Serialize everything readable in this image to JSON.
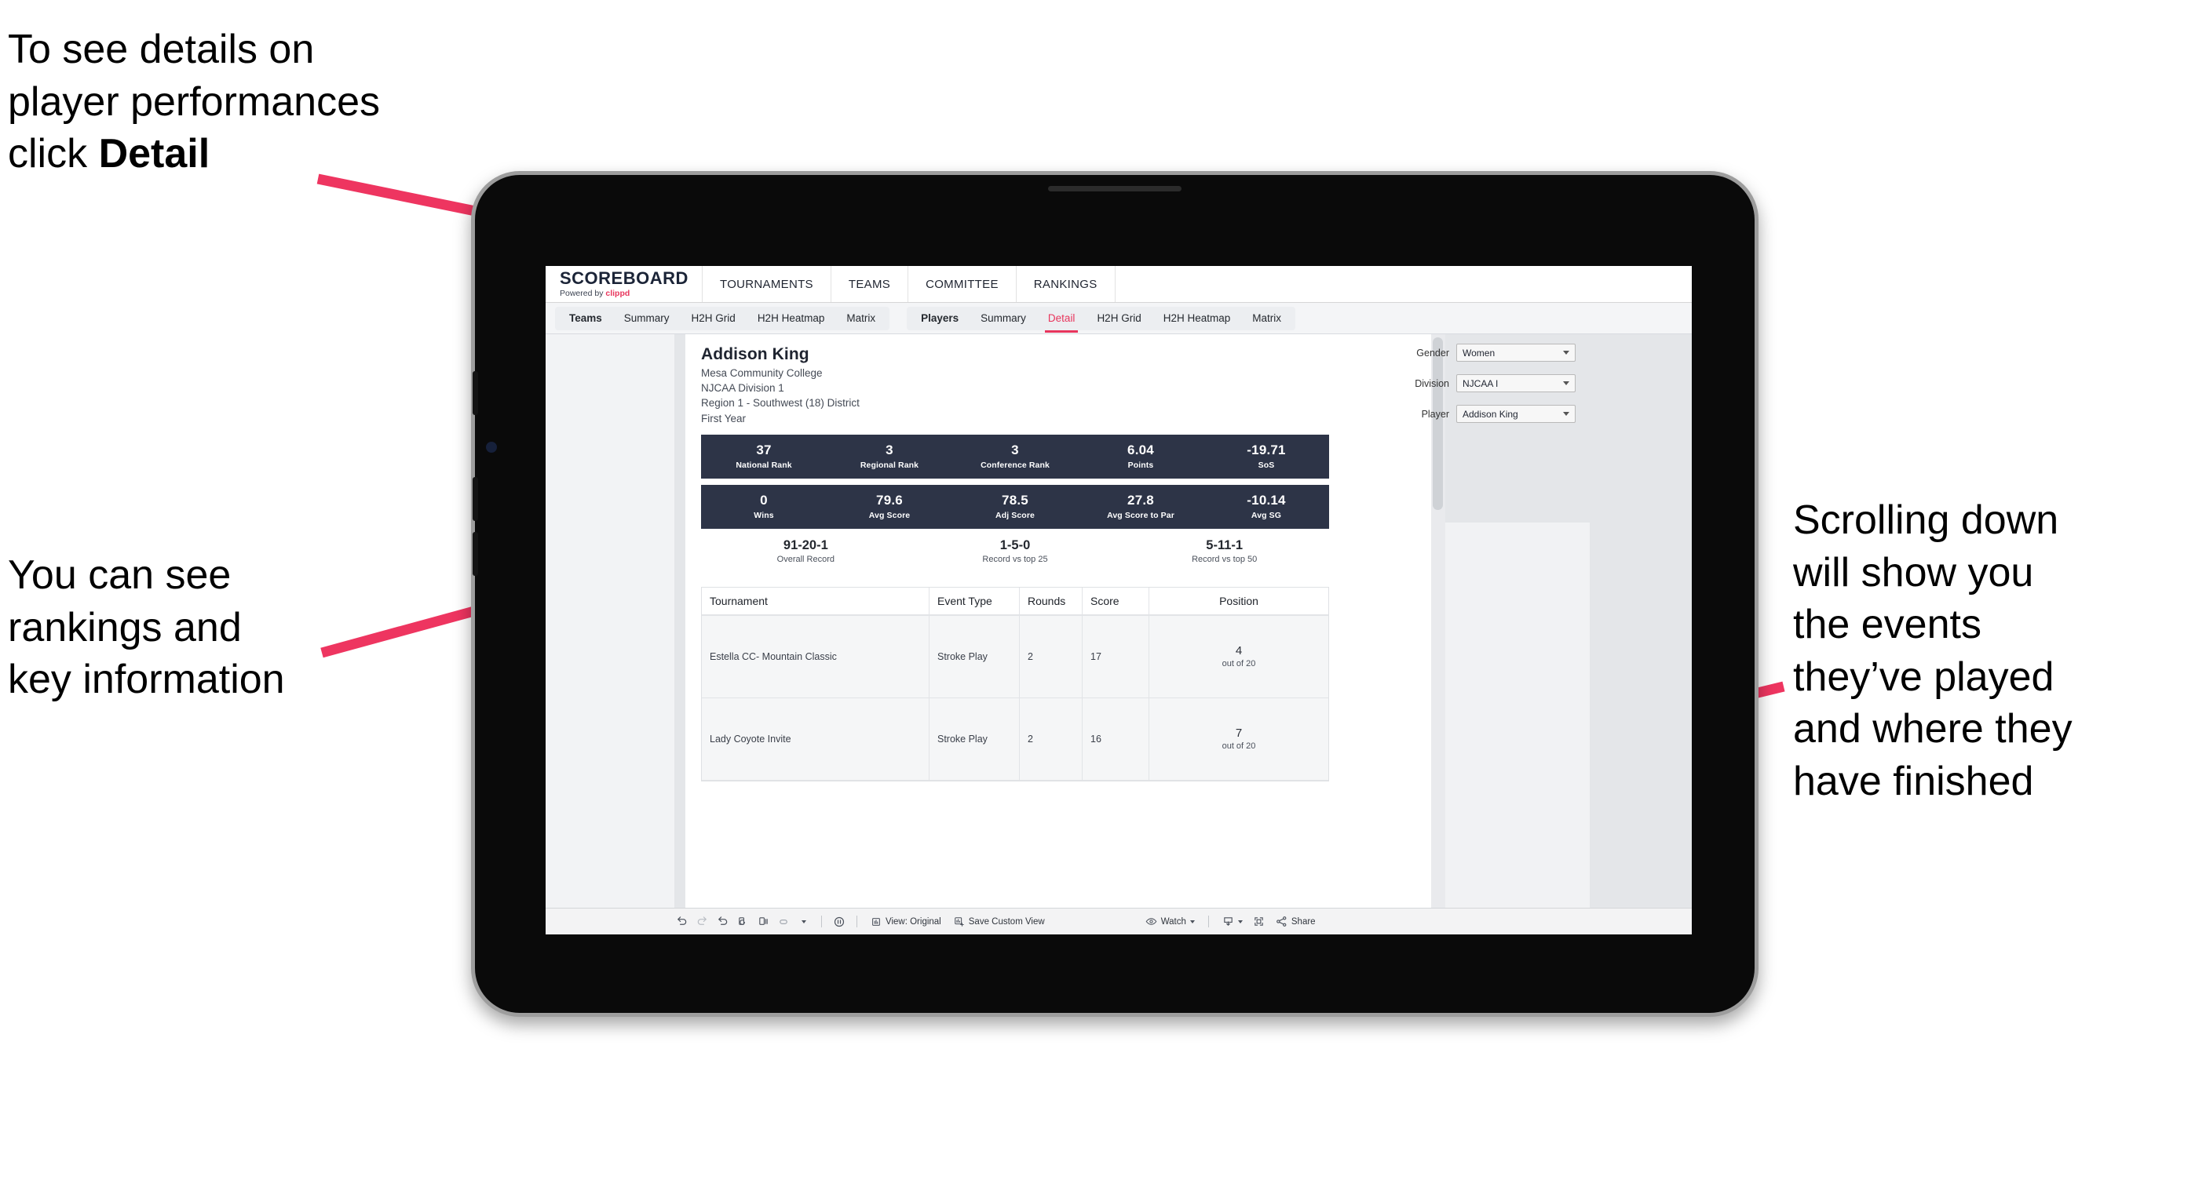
{
  "annotations": {
    "detail": "To see details on\nplayer performances\nclick ",
    "detail_bold": "Detail",
    "rankings": "You can see\nrankings and\nkey information",
    "scrolling": "Scrolling down\nwill show you\nthe events\nthey’ve played\nand where they\nhave finished"
  },
  "app": {
    "brand": {
      "title": "SCOREBOARD",
      "powered": "Powered by ",
      "vendor": "clippd"
    },
    "top_nav": [
      "TOURNAMENTS",
      "TEAMS",
      "COMMITTEE",
      "RANKINGS"
    ],
    "sub_nav_left": [
      "Teams",
      "Summary",
      "H2H Grid",
      "H2H Heatmap",
      "Matrix"
    ],
    "sub_nav_right": [
      "Players",
      "Summary",
      "Detail",
      "H2H Grid",
      "H2H Heatmap",
      "Matrix"
    ],
    "sub_nav_active": "Detail"
  },
  "player": {
    "name": "Addison King",
    "school": "Mesa Community College",
    "division": "NJCAA Division 1",
    "region": "Region 1 - Southwest (18) District",
    "year": "First Year"
  },
  "filters": [
    {
      "label": "Gender",
      "value": "Women"
    },
    {
      "label": "Division",
      "value": "NJCAA I"
    },
    {
      "label": "Player",
      "value": "Addison King"
    }
  ],
  "stats_row1": [
    {
      "value": "37",
      "label": "National Rank"
    },
    {
      "value": "3",
      "label": "Regional Rank"
    },
    {
      "value": "3",
      "label": "Conference Rank"
    },
    {
      "value": "6.04",
      "label": "Points"
    },
    {
      "value": "-19.71",
      "label": "SoS"
    }
  ],
  "stats_row2": [
    {
      "value": "0",
      "label": "Wins"
    },
    {
      "value": "79.6",
      "label": "Avg Score"
    },
    {
      "value": "78.5",
      "label": "Adj Score"
    },
    {
      "value": "27.8",
      "label": "Avg Score to Par"
    },
    {
      "value": "-10.14",
      "label": "Avg SG"
    }
  ],
  "records": [
    {
      "value": "91-20-1",
      "label": "Overall Record"
    },
    {
      "value": "1-5-0",
      "label": "Record vs top 25"
    },
    {
      "value": "5-11-1",
      "label": "Record vs top 50"
    }
  ],
  "table": {
    "headers": [
      "Tournament",
      "Event Type",
      "Rounds",
      "Score",
      "Position"
    ],
    "rows": [
      {
        "tournament": "Estella CC- Mountain Classic",
        "event_type": "Stroke Play",
        "rounds": "2",
        "score": "17",
        "position": "4",
        "position_sub": "out of 20"
      },
      {
        "tournament": "Lady Coyote Invite",
        "event_type": "Stroke Play",
        "rounds": "2",
        "score": "16",
        "position": "7",
        "position_sub": "out of 20"
      }
    ]
  },
  "toolbar": {
    "view_label": "View: Original",
    "save_label": "Save Custom View",
    "watch_label": "Watch",
    "share_label": "Share"
  },
  "colors": {
    "accent_pink": "#e8365d",
    "banner_navy": "#2d3447",
    "app_bg": "#e4e6e9"
  }
}
